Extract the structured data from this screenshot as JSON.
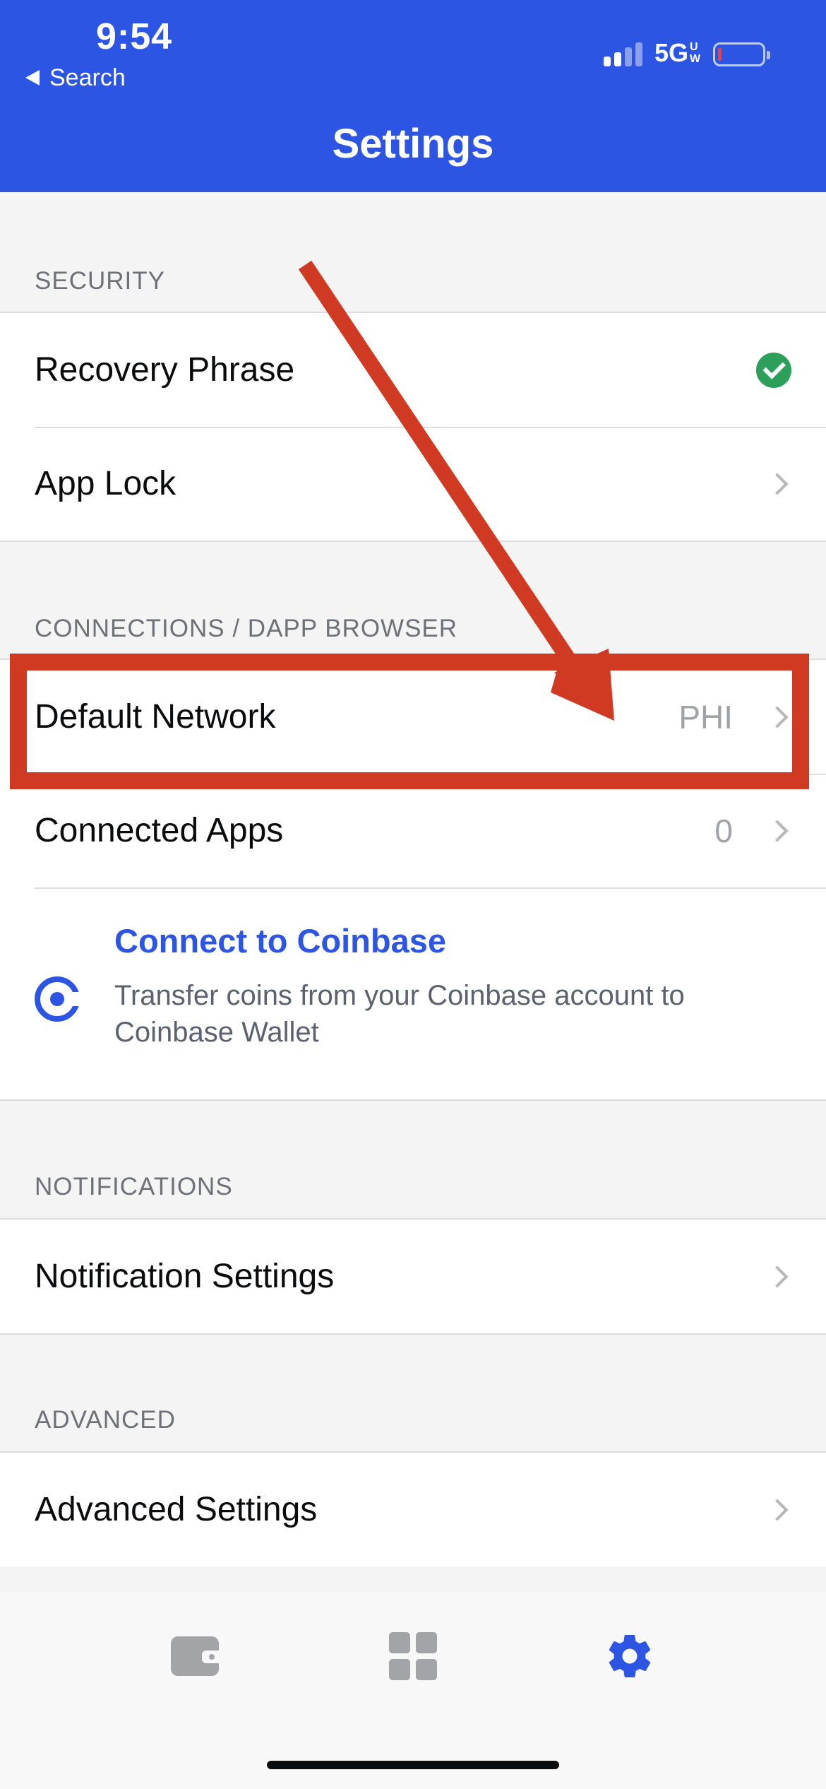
{
  "status_bar": {
    "time": "9:54",
    "back_label": "Search",
    "network": "5G",
    "network_sub_top": "U",
    "network_sub_bottom": "W"
  },
  "header": {
    "title": "Settings"
  },
  "sections": {
    "security": {
      "header": "SECURITY",
      "recovery_phrase": "Recovery Phrase",
      "app_lock": "App Lock"
    },
    "connections": {
      "header": "CONNECTIONS / DAPP BROWSER",
      "default_network": "Default Network",
      "default_network_value": "PHI",
      "connected_apps": "Connected Apps",
      "connected_apps_value": "0",
      "coinbase_title": "Connect to Coinbase",
      "coinbase_desc": "Transfer coins from your Coinbase account to Coinbase Wallet"
    },
    "notifications": {
      "header": "NOTIFICATIONS",
      "notification_settings": "Notification Settings"
    },
    "advanced": {
      "header": "ADVANCED",
      "advanced_settings": "Advanced Settings"
    }
  },
  "tabbar": {
    "tabs": [
      {
        "icon": "wallet-icon",
        "active": false
      },
      {
        "icon": "grid-icon",
        "active": false
      },
      {
        "icon": "gear-icon",
        "active": true
      }
    ]
  },
  "colors": {
    "brand_blue": "#2c55e3",
    "annotation_red": "#d03a22",
    "check_green": "#2ca05a"
  }
}
